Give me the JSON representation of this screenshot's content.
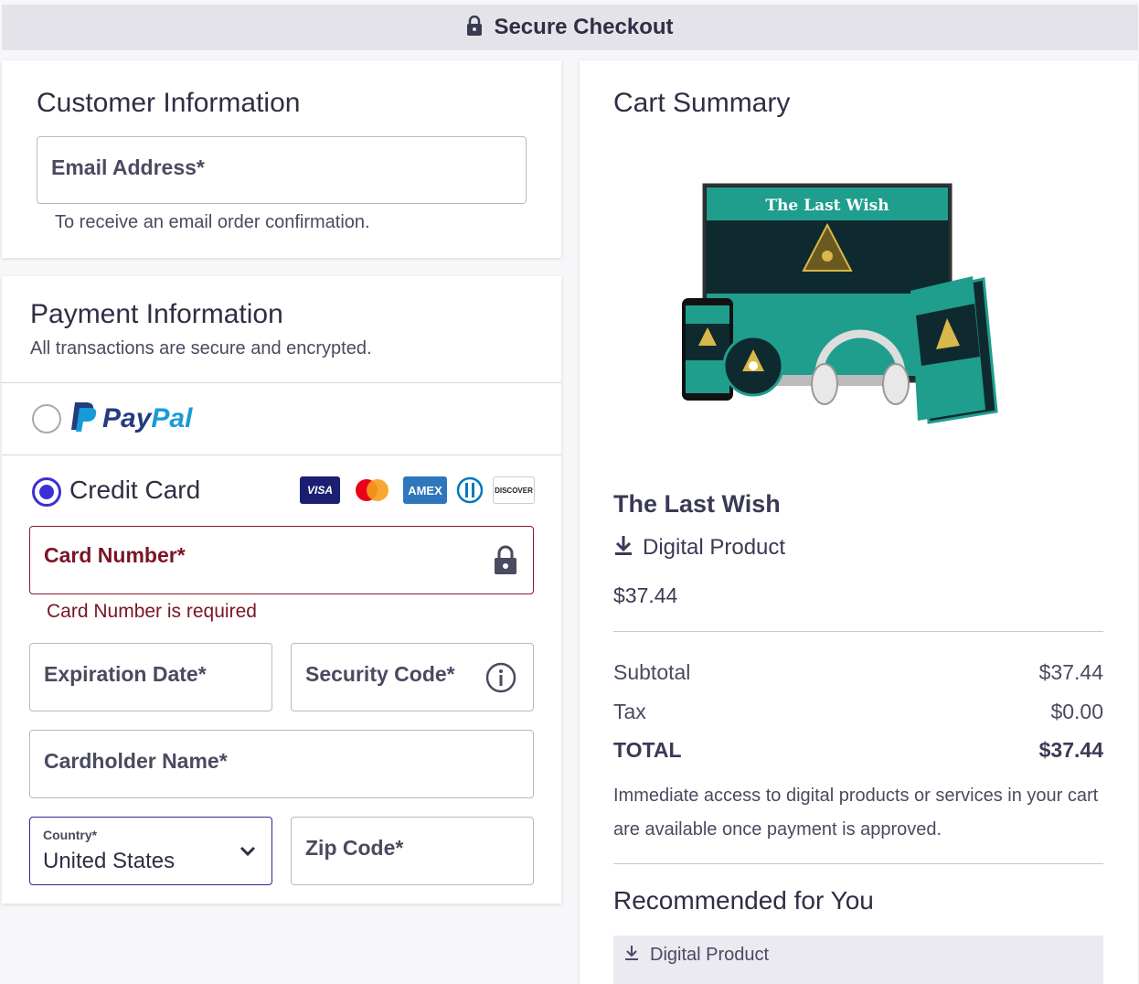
{
  "header": {
    "title": "Secure Checkout"
  },
  "customer": {
    "title": "Customer Information",
    "email_label": "Email Address*",
    "email_hint": "To receive an email order confirmation."
  },
  "payment": {
    "title": "Payment Information",
    "subtitle": "All transactions are secure and encrypted.",
    "paypal": {
      "pay": "Pay",
      "pal": "Pal",
      "selected": false
    },
    "credit_card": {
      "label": "Credit Card",
      "selected": true
    },
    "brands": [
      "VISA",
      "Mastercard",
      "AMEX",
      "Diners",
      "DISCOVER"
    ],
    "card_number_label": "Card Number*",
    "card_number_error": "Card Number is required",
    "expiration_label": "Expiration Date*",
    "security_label": "Security Code*",
    "cardholder_label": "Cardholder Name*",
    "country_label": "Country*",
    "country_value": "United States",
    "zip_label": "Zip Code*"
  },
  "cart": {
    "title": "Cart Summary",
    "product_image_title": "The Last Wish",
    "product_name": "The Last Wish",
    "product_type": "Digital Product",
    "product_price": "$37.44",
    "subtotal_label": "Subtotal",
    "subtotal_value": "$37.44",
    "tax_label": "Tax",
    "tax_value": "$0.00",
    "total_label": "TOTAL",
    "total_value": "$37.44",
    "access_note": "Immediate access to digital products or services in your cart are available once payment is approved.",
    "recommended_title": "Recommended for You",
    "recommended_item_type": "Digital Product"
  },
  "colors": {
    "accent": "#3b2fd6",
    "error": "#7a1424",
    "teal": "#1f9e8e",
    "paypal_dark": "#253b80",
    "paypal_light": "#179bd7"
  }
}
